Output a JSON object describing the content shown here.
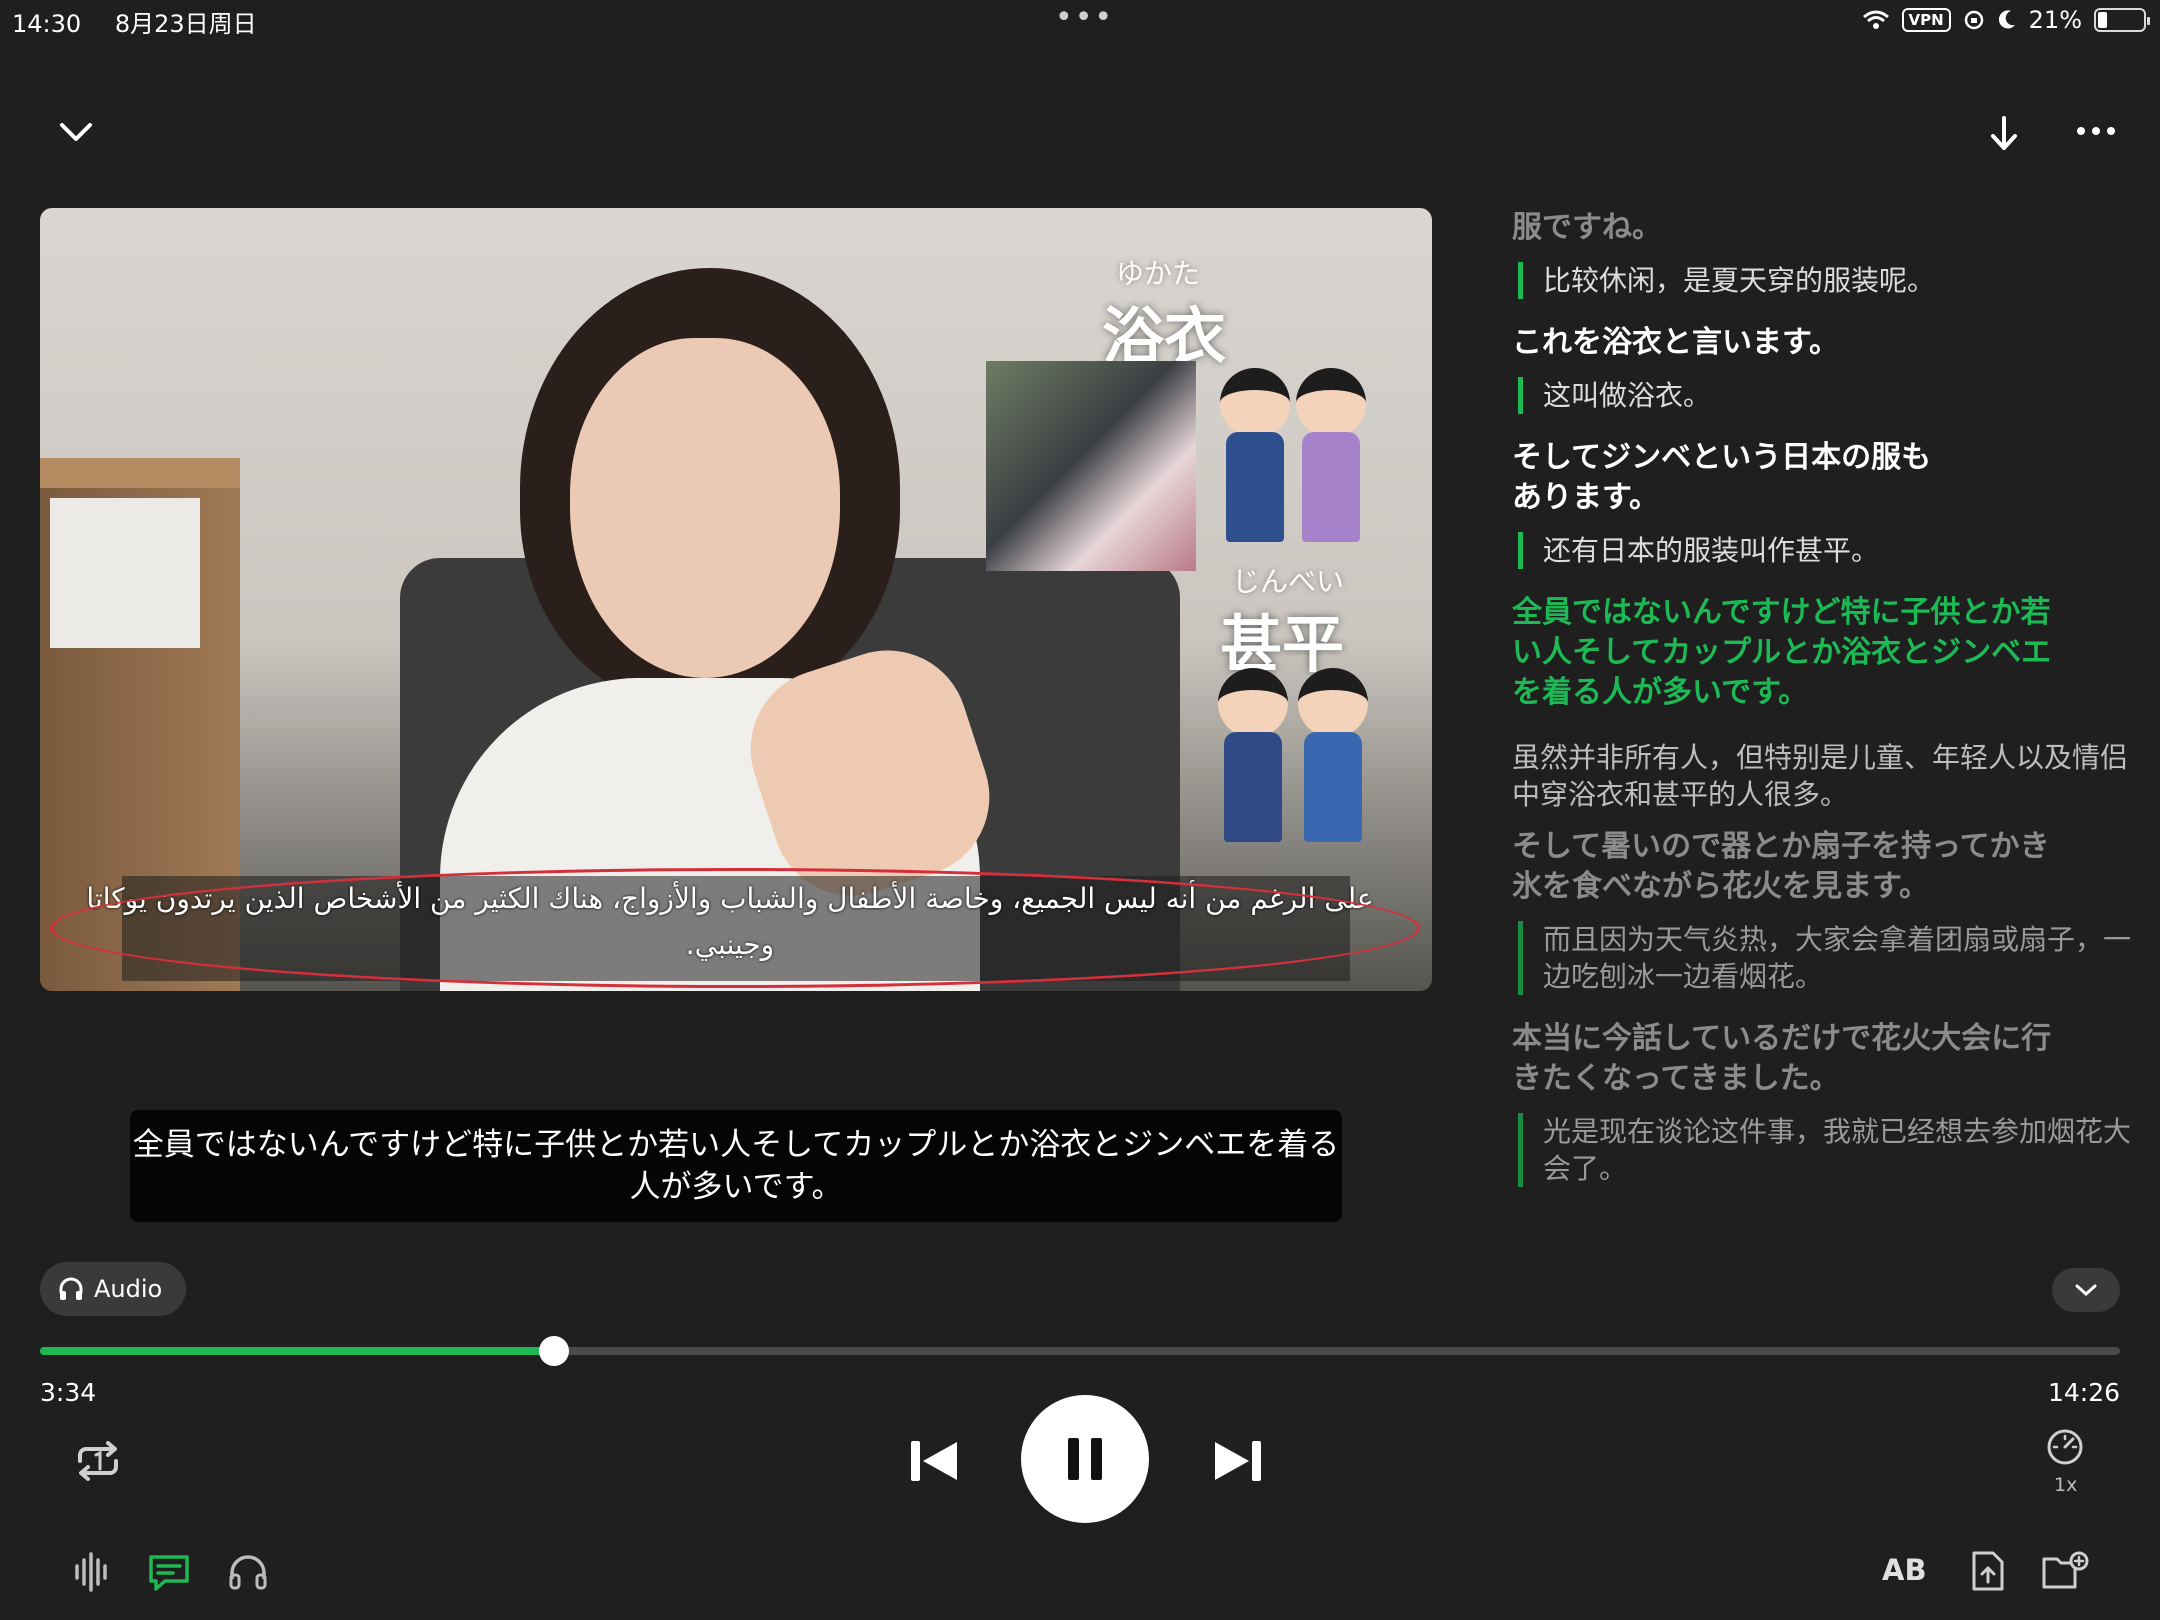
{
  "status_bar": {
    "time": "14:30",
    "date": "8月23日周日",
    "dots": "•••",
    "vpn": "VPN",
    "battery": "21%",
    "battery_level": 0.21
  },
  "video": {
    "label_yukata_kana": "ゆかた",
    "label_yukata": "浴衣",
    "label_jinbei_kana": "じんべい",
    "label_jinbei": "甚平",
    "subtitle_arabic": "على الرغم من أنه ليس الجميع، وخاصة الأطفال والشباب والأزواج، هناك الكثير من الأشخاص الذين يرتدون يوكاتا وجينبي."
  },
  "caption": {
    "text": "全員ではないんですけど特に子供とか若い人そしてカップルとか浴衣とジンベエを着る人が多いです。"
  },
  "transcript": {
    "items": [
      {
        "jp": "服ですね。",
        "cn": "比较休闲，是夏天穿的服装呢。"
      },
      {
        "jp": "これを浴衣と言います。",
        "cn": "这叫做浴衣。"
      },
      {
        "jp": "そしてジンベという日本の服もあります。",
        "cn": "还有日本的服装叫作甚平。"
      },
      {
        "jp": "全員ではないんですけど特に子供とか若い人そしてカップルとか浴衣とジンベエを着る人が多いです。",
        "cn": "虽然并非所有人，但特别是儿童、年轻人以及情侣中穿浴衣和甚平的人很多。"
      },
      {
        "jp": "そして暑いので器とか扇子を持ってかき氷を食べながら花火を見ます。",
        "cn": "而且因为天气炎热，大家会拿着团扇或扇子，一边吃刨冰一边看烟花。"
      },
      {
        "jp": "本当に今話しているだけで花火大会に行きたくなってきました。",
        "cn": "光是现在谈论这件事，我就已经想去参加烟花大会了。"
      }
    ]
  },
  "audio_pill": {
    "label": "Audio"
  },
  "playback": {
    "elapsed": "3:34",
    "total": "14:26",
    "progress": 0.247,
    "speed": "1x"
  },
  "bottom_bar": {
    "ab_label": "AB"
  },
  "colors": {
    "accent": "#1db954",
    "background": "#1f1f1f"
  }
}
